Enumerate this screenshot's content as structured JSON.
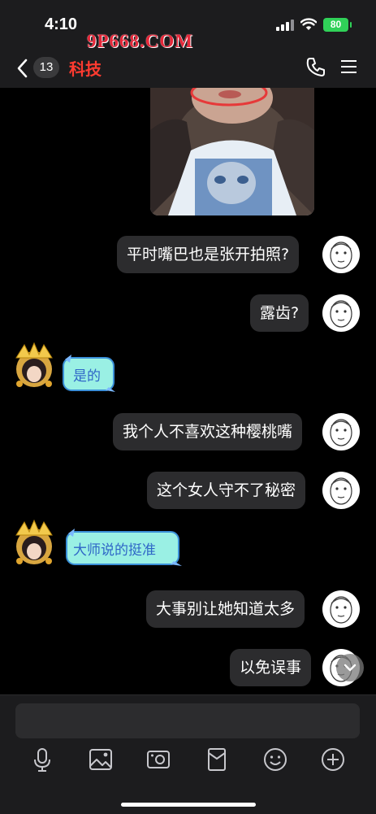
{
  "status_bar": {
    "time": "4:10",
    "battery": "80"
  },
  "watermark": "9P668.COM",
  "header": {
    "unread_count": "13",
    "title": "科技"
  },
  "messages": [
    {
      "side": "right",
      "text": "平时嘴巴也是张开拍照?"
    },
    {
      "side": "right",
      "text": "露齿?"
    },
    {
      "side": "left",
      "sticker": "是的"
    },
    {
      "side": "right",
      "text": "我个人不喜欢这种樱桃嘴"
    },
    {
      "side": "right",
      "text": "这个女人守不了秘密"
    },
    {
      "side": "left",
      "sticker": "大师说的挺准"
    },
    {
      "side": "right",
      "text": "大事别让她知道太多"
    },
    {
      "side": "right",
      "text": "以免误事"
    }
  ],
  "toolbar": [
    "microphone-icon",
    "image-icon",
    "camera-icon",
    "red-packet-icon",
    "emoji-icon",
    "plus-icon"
  ],
  "colors": {
    "title": "#ff3b30",
    "bubble": "#2c2c2e",
    "battery": "#30d158",
    "watermark": "#e5283a"
  }
}
